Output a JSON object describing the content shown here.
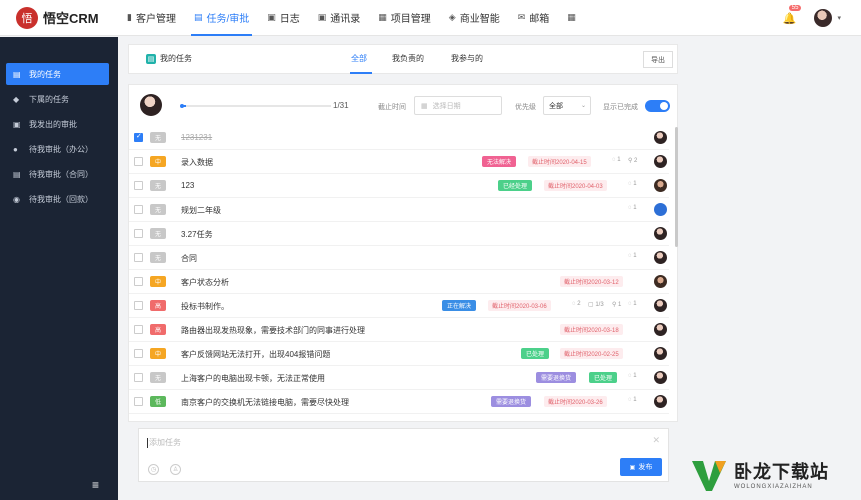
{
  "app": {
    "logo_text": "悟空CRM",
    "logo_glyph": "悟"
  },
  "nav": [
    {
      "label": "客户管理",
      "icon": "bar-chart-icon",
      "glyph": "▮"
    },
    {
      "label": "任务/审批",
      "icon": "briefcase-icon",
      "glyph": "▤",
      "active": true
    },
    {
      "label": "日志",
      "icon": "log-book-icon",
      "glyph": "▣"
    },
    {
      "label": "通讯录",
      "icon": "contacts-icon",
      "glyph": "▣"
    },
    {
      "label": "项目管理",
      "icon": "project-icon",
      "glyph": "▦"
    },
    {
      "label": "商业智能",
      "icon": "shield-icon",
      "glyph": "◈"
    },
    {
      "label": "邮箱",
      "icon": "mail-icon",
      "glyph": "✉"
    },
    {
      "label": "",
      "icon": "apps-grid-icon",
      "glyph": "▦"
    }
  ],
  "header": {
    "notification_count": "55",
    "bell_glyph": "🔔",
    "caret_glyph": "▾"
  },
  "sidebar": [
    {
      "label": "我的任务",
      "icon": "task-list-icon",
      "glyph": "▤",
      "active": true
    },
    {
      "label": "下属的任务",
      "icon": "layers-icon",
      "glyph": "◆"
    },
    {
      "label": "我发出的审批",
      "icon": "approval-sent-icon",
      "glyph": "▣"
    },
    {
      "label": "待我审批（办公）",
      "icon": "user-icon",
      "glyph": "●"
    },
    {
      "label": "待我审批（合同）",
      "icon": "contract-icon",
      "glyph": "▤"
    },
    {
      "label": "待我审批（回款）",
      "icon": "money-bag-icon",
      "glyph": "◉"
    }
  ],
  "sidebar_footer": {
    "collapse_glyph": "≡"
  },
  "tabs_bar": {
    "title": "我的任务",
    "title_glyph": "▤",
    "tabs": [
      "全部",
      "我负责的",
      "我参与的"
    ],
    "export_label": "导出"
  },
  "filters": {
    "progress_text": "1/31",
    "progress_fraction": 0.032,
    "deadline_label": "截止时间",
    "date_placeholder": "选择日期",
    "date_glyph": "▦",
    "priority_label": "优先级",
    "priority_value": "全部",
    "priority_arrow": "⌄",
    "show_completed_label": "显示已完成",
    "show_completed": true
  },
  "priority_colors": {
    "无": "#c8c8c8",
    "中": "#f5a623",
    "高": "#f06b6b",
    "低": "#5cb85c"
  },
  "tasks": [
    {
      "done": true,
      "priority": "无",
      "title": "1231231",
      "tags": [],
      "deadline": "",
      "stats": []
    },
    {
      "done": false,
      "priority": "中",
      "title": "录入数据",
      "tags": [
        {
          "text": "无法解决",
          "color": "#f06292"
        }
      ],
      "deadline": "截止时间2020-04-15",
      "stats": [
        "◌ 1",
        "⚲ 2"
      ]
    },
    {
      "done": false,
      "priority": "无",
      "title": "123",
      "tags": [
        {
          "text": "已经处理",
          "color": "#4cd08a"
        }
      ],
      "deadline": "截止时间2020-04-03",
      "stats": [
        "◌ 1"
      ]
    },
    {
      "done": false,
      "priority": "无",
      "title": "规划二年级",
      "tags": [],
      "deadline": "",
      "stats": [
        "◌ 1"
      ]
    },
    {
      "done": false,
      "priority": "无",
      "title": "3.27任务",
      "tags": [],
      "deadline": "",
      "stats": []
    },
    {
      "done": false,
      "priority": "无",
      "title": "合同",
      "tags": [],
      "deadline": "",
      "stats": [
        "◌ 1"
      ]
    },
    {
      "done": false,
      "priority": "中",
      "title": "客户状态分析",
      "tags": [],
      "deadline": "截止时间2020-03-12",
      "stats": []
    },
    {
      "done": false,
      "priority": "高",
      "title": "投标书制作。",
      "tags": [
        {
          "text": "正在解决",
          "color": "#3a8ee6"
        }
      ],
      "deadline": "截止时间2020-03-06",
      "stats": [
        "◌ 2",
        "▢ 1/3",
        "⚲ 1",
        "◌ 1"
      ]
    },
    {
      "done": false,
      "priority": "高",
      "title": "路由器出现发热现象，需要技术部门的同事进行处理",
      "tags": [],
      "deadline": "截止时间2020-03-18",
      "stats": []
    },
    {
      "done": false,
      "priority": "中",
      "title": "客户反馈网站无法打开，出现404报错问题",
      "tags": [
        {
          "text": "已处理",
          "color": "#4cd08a"
        }
      ],
      "deadline": "截止时间2020-02-25",
      "stats": []
    },
    {
      "done": false,
      "priority": "无",
      "title": "上海客户的电脑出现卡顿，无法正常使用",
      "tags": [
        {
          "text": "需要退换货",
          "color": "#9c8ee0"
        },
        {
          "text": "已处理",
          "color": "#4cd08a"
        }
      ],
      "deadline": "",
      "stats": [
        "◌ 1"
      ]
    },
    {
      "done": false,
      "priority": "低",
      "title": "南京客户的交换机无法链接电脑，需要尽快处理",
      "tags": [
        {
          "text": "需要退换货",
          "color": "#9c8ee0"
        }
      ],
      "deadline": "截止时间2020-03-26",
      "stats": [
        "◌ 1"
      ]
    }
  ],
  "add_task": {
    "placeholder": "添加任务",
    "publish_label": "发布",
    "publish_glyph": "▣",
    "clear_glyph": "✕",
    "tools": [
      "◷",
      "♙"
    ]
  },
  "watermark": {
    "title": "卧龙下载站",
    "sub": "WOLONGXIAZAIZHAN"
  }
}
